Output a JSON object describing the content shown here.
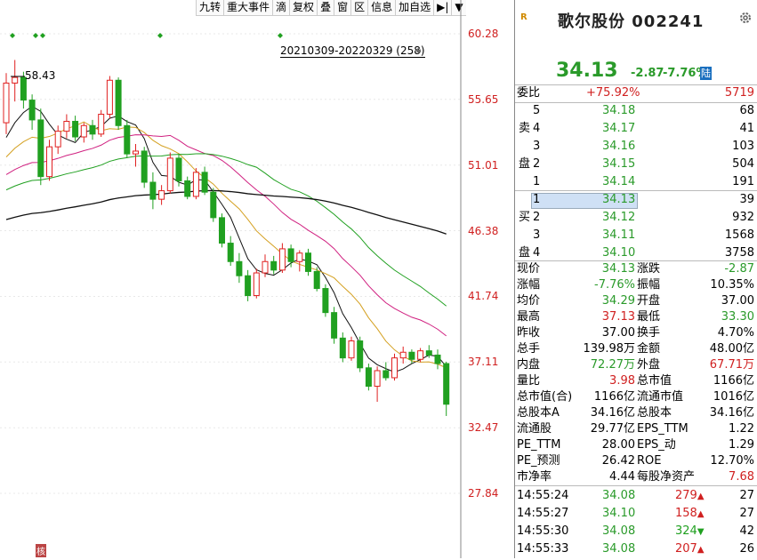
{
  "toolbar": {
    "items": [
      "九转",
      "重大事件",
      "滴",
      "复权",
      "叠",
      "窗",
      "区",
      "信息",
      "加自选",
      "▶|",
      "▼"
    ]
  },
  "chart": {
    "range_label": "20210309-20220329 (258)",
    "max_label": "58.43",
    "yticks": [
      "60.28",
      "55.65",
      "51.01",
      "46.38",
      "41.74",
      "37.11",
      "32.47",
      "27.84"
    ],
    "corner_mark": "核"
  },
  "chart_data": {
    "type": "candlestick",
    "ylim": [
      27.84,
      60.28
    ],
    "yticks": [
      60.28,
      55.65,
      51.01,
      46.38,
      41.74,
      37.11,
      32.47,
      27.84
    ],
    "annotations": [
      "58.43",
      "20210309-20220329 (258)"
    ],
    "candles": [
      [
        54.0,
        57.5,
        53.2,
        56.8
      ],
      [
        56.8,
        58.43,
        55.5,
        57.2
      ],
      [
        57.2,
        57.6,
        55.0,
        55.6
      ],
      [
        55.6,
        56.0,
        53.5,
        54.2
      ],
      [
        54.2,
        55.0,
        49.6,
        50.2
      ],
      [
        50.2,
        52.8,
        49.9,
        52.3
      ],
      [
        52.3,
        53.8,
        51.8,
        53.4
      ],
      [
        53.4,
        54.6,
        52.9,
        54.1
      ],
      [
        54.1,
        54.5,
        52.7,
        53.0
      ],
      [
        53.0,
        54.0,
        52.6,
        53.8
      ],
      [
        53.8,
        54.2,
        52.8,
        53.2
      ],
      [
        53.2,
        54.9,
        53.0,
        54.6
      ],
      [
        54.6,
        57.3,
        54.3,
        57.0
      ],
      [
        57.0,
        57.2,
        53.5,
        53.8
      ],
      [
        53.8,
        54.2,
        51.5,
        51.8
      ],
      [
        51.8,
        52.5,
        50.9,
        52.0
      ],
      [
        52.0,
        52.3,
        49.4,
        49.8
      ],
      [
        49.8,
        50.5,
        47.9,
        48.6
      ],
      [
        48.6,
        49.6,
        48.2,
        49.2
      ],
      [
        49.2,
        51.9,
        49.0,
        51.5
      ],
      [
        51.5,
        51.8,
        49.5,
        49.9
      ],
      [
        49.9,
        50.2,
        48.6,
        48.8
      ],
      [
        48.8,
        50.8,
        48.6,
        50.5
      ],
      [
        50.5,
        50.9,
        48.9,
        49.1
      ],
      [
        49.1,
        49.4,
        47.0,
        47.3
      ],
      [
        47.3,
        47.6,
        45.2,
        45.5
      ],
      [
        45.5,
        46.0,
        43.9,
        44.2
      ],
      [
        44.2,
        44.8,
        42.7,
        43.2
      ],
      [
        43.2,
        43.6,
        41.4,
        41.8
      ],
      [
        41.8,
        43.7,
        41.6,
        43.4
      ],
      [
        43.4,
        44.7,
        43.1,
        44.2
      ],
      [
        44.2,
        44.6,
        43.3,
        43.6
      ],
      [
        43.6,
        45.5,
        43.4,
        45.1
      ],
      [
        45.1,
        45.4,
        43.8,
        44.2
      ],
      [
        44.2,
        45.0,
        43.5,
        44.8
      ],
      [
        44.8,
        45.1,
        43.2,
        43.5
      ],
      [
        43.5,
        43.8,
        42.1,
        42.3
      ],
      [
        42.3,
        42.6,
        40.3,
        40.6
      ],
      [
        40.6,
        41.0,
        38.4,
        38.8
      ],
      [
        38.8,
        39.2,
        37.1,
        37.4
      ],
      [
        37.4,
        38.9,
        37.2,
        38.6
      ],
      [
        38.6,
        38.9,
        36.4,
        36.7
      ],
      [
        36.7,
        37.0,
        35.1,
        35.4
      ],
      [
        35.4,
        36.8,
        34.3,
        36.5
      ],
      [
        36.5,
        37.1,
        35.8,
        36.0
      ],
      [
        36.0,
        37.7,
        35.8,
        37.4
      ],
      [
        37.4,
        38.2,
        37.0,
        37.8
      ],
      [
        37.8,
        38.0,
        37.0,
        37.3
      ],
      [
        37.3,
        38.1,
        37.1,
        37.9
      ],
      [
        37.9,
        38.3,
        37.4,
        37.6
      ],
      [
        37.6,
        38.0,
        36.6,
        37.0
      ],
      [
        37.0,
        37.13,
        33.3,
        34.13
      ]
    ]
  },
  "stock": {
    "name": "歌尔股份",
    "code": "002241",
    "badge": "R",
    "price": "34.13",
    "change": "-2.87",
    "pct": "-7.76%",
    "market": "陆"
  },
  "weibi": {
    "label": "委比",
    "value": "+75.92%",
    "vol": "5719"
  },
  "sell_label": [
    "卖",
    "盘"
  ],
  "buy_label": [
    "买",
    "盘"
  ],
  "sell": [
    {
      "lvl": "5",
      "price": "34.18",
      "vol": "68"
    },
    {
      "lvl": "4",
      "price": "34.17",
      "vol": "41"
    },
    {
      "lvl": "3",
      "price": "34.16",
      "vol": "103"
    },
    {
      "lvl": "2",
      "price": "34.15",
      "vol": "504"
    },
    {
      "lvl": "1",
      "price": "34.14",
      "vol": "191"
    }
  ],
  "buy": [
    {
      "lvl": "1",
      "price": "34.13",
      "vol": "39"
    },
    {
      "lvl": "2",
      "price": "34.12",
      "vol": "932"
    },
    {
      "lvl": "3",
      "price": "34.11",
      "vol": "1568"
    },
    {
      "lvl": "4",
      "price": "34.10",
      "vol": "3758"
    }
  ],
  "stats": [
    {
      "k1": "现价",
      "v1": "34.13",
      "c1": "green",
      "k2": "涨跌",
      "v2": "-2.87",
      "c2": "green"
    },
    {
      "k1": "涨幅",
      "v1": "-7.76%",
      "c1": "green",
      "k2": "振幅",
      "v2": "10.35%",
      "c2": "blk"
    },
    {
      "k1": "均价",
      "v1": "34.29",
      "c1": "green",
      "k2": "开盘",
      "v2": "37.00",
      "c2": "blk"
    },
    {
      "k1": "最高",
      "v1": "37.13",
      "c1": "red",
      "k2": "最低",
      "v2": "33.30",
      "c2": "green"
    },
    {
      "k1": "昨收",
      "v1": "37.00",
      "c1": "blk",
      "k2": "换手",
      "v2": "4.70%",
      "c2": "blk"
    },
    {
      "k1": "总手",
      "v1": "139.98万",
      "c1": "blk",
      "k2": "金额",
      "v2": "48.00亿",
      "c2": "blk"
    },
    {
      "k1": "内盘",
      "v1": "72.27万",
      "c1": "green",
      "k2": "外盘",
      "v2": "67.71万",
      "c2": "red"
    },
    {
      "k1": "量比",
      "v1": "3.98",
      "c1": "red",
      "k2": "总市值",
      "v2": "1166亿",
      "c2": "blk"
    },
    {
      "k1": "总市值(合)",
      "v1": "1166亿",
      "c1": "blk",
      "k2": "流通市值",
      "v2": "1016亿",
      "c2": "blk"
    },
    {
      "k1": "总股本A",
      "v1": "34.16亿",
      "c1": "blk",
      "k2": "总股本",
      "v2": "34.16亿",
      "c2": "blk"
    },
    {
      "k1": "流通股",
      "v1": "29.77亿",
      "c1": "blk",
      "k2": "EPS_TTM",
      "v2": "1.22",
      "c2": "blk"
    },
    {
      "k1": "PE_TTM",
      "v1": "28.00",
      "c1": "blk",
      "k2": "EPS_动",
      "v2": "1.29",
      "c2": "blk"
    },
    {
      "k1": "PE_预测",
      "v1": "26.42",
      "c1": "blk",
      "k2": "ROE",
      "v2": "12.70%",
      "c2": "blk"
    },
    {
      "k1": "市净率",
      "v1": "4.44",
      "c1": "blk",
      "k2": "每股净资产",
      "v2": "7.68",
      "c2": "red"
    }
  ],
  "ticks": [
    {
      "time": "14:55:24",
      "price": "34.08",
      "vol": "279",
      "dir": "up",
      "n": "27"
    },
    {
      "time": "14:55:27",
      "price": "34.10",
      "vol": "158",
      "dir": "up",
      "n": "27"
    },
    {
      "time": "14:55:30",
      "price": "34.08",
      "vol": "324",
      "dir": "down",
      "n": "42"
    },
    {
      "time": "14:55:33",
      "price": "34.08",
      "vol": "207",
      "dir": "up",
      "n": "26"
    }
  ]
}
